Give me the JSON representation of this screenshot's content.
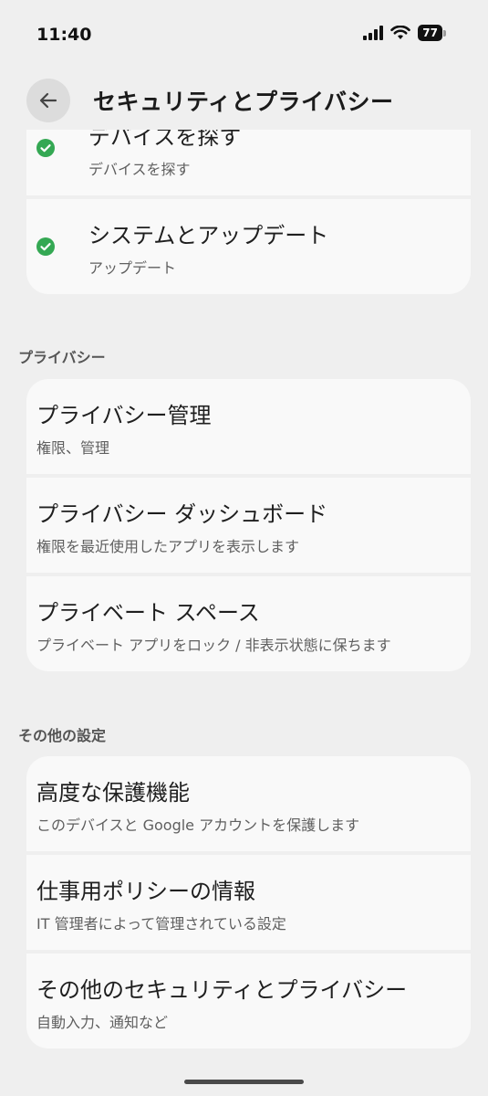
{
  "status_bar": {
    "time": "11:40",
    "battery_level": "77",
    "icons": [
      "signal-icon",
      "wifi-icon",
      "battery-icon"
    ]
  },
  "header": {
    "back_icon": "arrow-left-icon",
    "title": "セキュリティとプライバシー"
  },
  "top_group": {
    "items": [
      {
        "title": "デバイスを探す",
        "subtitle": "デバイスを探す",
        "status": "ok"
      },
      {
        "title": "システムとアップデート",
        "subtitle": "アップデート",
        "status": "ok"
      }
    ]
  },
  "privacy": {
    "header": "プライバシー",
    "items": [
      {
        "title": "プライバシー管理",
        "subtitle": "権限、管理"
      },
      {
        "title": "プライバシー ダッシュボード",
        "subtitle": "権限を最近使用したアプリを表示します"
      },
      {
        "title": "プライベート スペース",
        "subtitle": "プライベート アプリをロック / 非表示状態に保ちます"
      }
    ]
  },
  "other": {
    "header": "その他の設定",
    "items": [
      {
        "title": "高度な保護機能",
        "subtitle": "このデバイスと Google アカウントを保護します"
      },
      {
        "title": "仕事用ポリシーの情報",
        "subtitle": "IT 管理者によって管理されている設定"
      },
      {
        "title": "その他のセキュリティとプライバシー",
        "subtitle": "自動入力、通知など"
      }
    ]
  },
  "colors": {
    "background": "#efefef",
    "card": "#f9f9f9",
    "check_green": "#34a853"
  }
}
